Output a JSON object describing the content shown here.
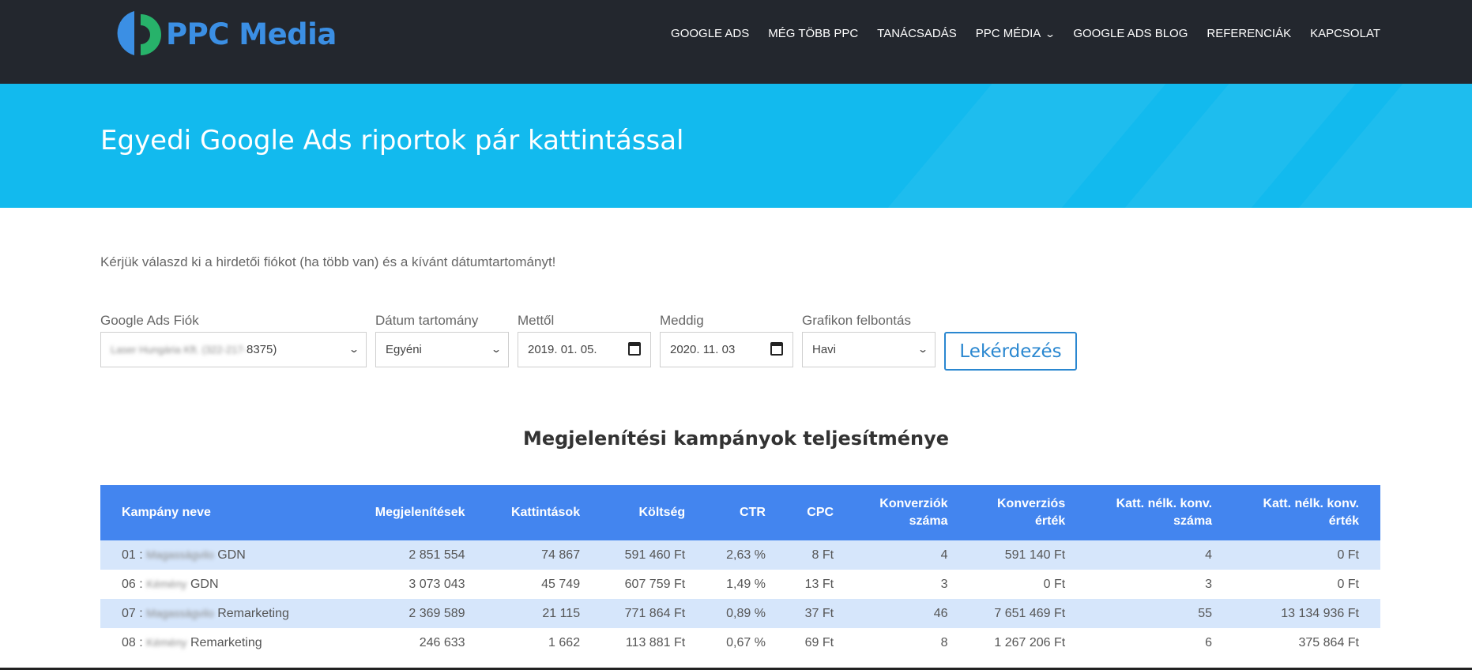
{
  "header": {
    "logo_text": "PPC Media",
    "nav": [
      {
        "label": "GOOGLE ADS"
      },
      {
        "label": "MÉG TÖBB PPC"
      },
      {
        "label": "TANÁCSADÁS"
      },
      {
        "label": "PPC MÉDIA",
        "has_dropdown": true
      },
      {
        "label": "GOOGLE ADS BLOG"
      },
      {
        "label": "REFERENCIÁK"
      },
      {
        "label": "KAPCSOLAT"
      }
    ]
  },
  "hero": {
    "title": "Egyedi Google Ads riportok pár kattintással"
  },
  "intro": "Kérjük válaszd ki a hirdetői fiókot (ha több van) és a kívánt dátumtartományt!",
  "form": {
    "account": {
      "label": "Google Ads Fiók",
      "value_blurred": "Laser Hungária Kft. (322-217-",
      "value_visible": "8375)"
    },
    "range": {
      "label": "Dátum tartomány",
      "value": "Egyéni"
    },
    "from": {
      "label": "Mettől",
      "value": "2019. 01. 05."
    },
    "to": {
      "label": "Meddig",
      "value": "2020. 11. 03"
    },
    "resolution": {
      "label": "Grafikon felbontás",
      "value": "Havi"
    },
    "submit_label": "Lekérdezés"
  },
  "section_title": "Megjelenítési kampányok teljesítménye",
  "table": {
    "columns": [
      {
        "line1": "Kampány neve",
        "line2": ""
      },
      {
        "line1": "Megjelenítések",
        "line2": ""
      },
      {
        "line1": "Kattintások",
        "line2": ""
      },
      {
        "line1": "Költség",
        "line2": ""
      },
      {
        "line1": "CTR",
        "line2": ""
      },
      {
        "line1": "CPC",
        "line2": ""
      },
      {
        "line1": "Konverziók",
        "line2": "száma"
      },
      {
        "line1": "Konverziós",
        "line2": "érték"
      },
      {
        "line1": "Katt. nélk. konv.",
        "line2": "száma"
      },
      {
        "line1": "Katt. nélk. konv.",
        "line2": "érték"
      }
    ],
    "rows": [
      {
        "prefix": "01 : ",
        "blurred": "Magasságvilo",
        "suffix": " GDN",
        "cells": [
          "2 851 554",
          "74 867",
          "591 460 Ft",
          "2,63 %",
          "8 Ft",
          "4",
          "591 140 Ft",
          "4",
          "0 Ft"
        ]
      },
      {
        "prefix": "06 : ",
        "blurred": "Kémény",
        "suffix": " GDN",
        "cells": [
          "3 073 043",
          "45 749",
          "607 759 Ft",
          "1,49 %",
          "13 Ft",
          "3",
          "0 Ft",
          "3",
          "0 Ft"
        ]
      },
      {
        "prefix": "07 : ",
        "blurred": "Magasságvilo",
        "suffix": " Remarketing",
        "cells": [
          "2 369 589",
          "21 115",
          "771 864 Ft",
          "0,89 %",
          "37 Ft",
          "46",
          "7 651 469 Ft",
          "55",
          "13 134 936 Ft"
        ]
      },
      {
        "prefix": "08 : ",
        "blurred": "Kémény",
        "suffix": " Remarketing",
        "cells": [
          "246 633",
          "1 662",
          "113 881 Ft",
          "0,67 %",
          "69 Ft",
          "8",
          "1 267 206 Ft",
          "6",
          "375 864 Ft"
        ]
      }
    ]
  },
  "colors": {
    "topbar": "#23272e",
    "hero": "#12baee",
    "table_header": "#4385ef",
    "row_stripe": "#d6e6fb",
    "accent": "#2a87d0"
  }
}
